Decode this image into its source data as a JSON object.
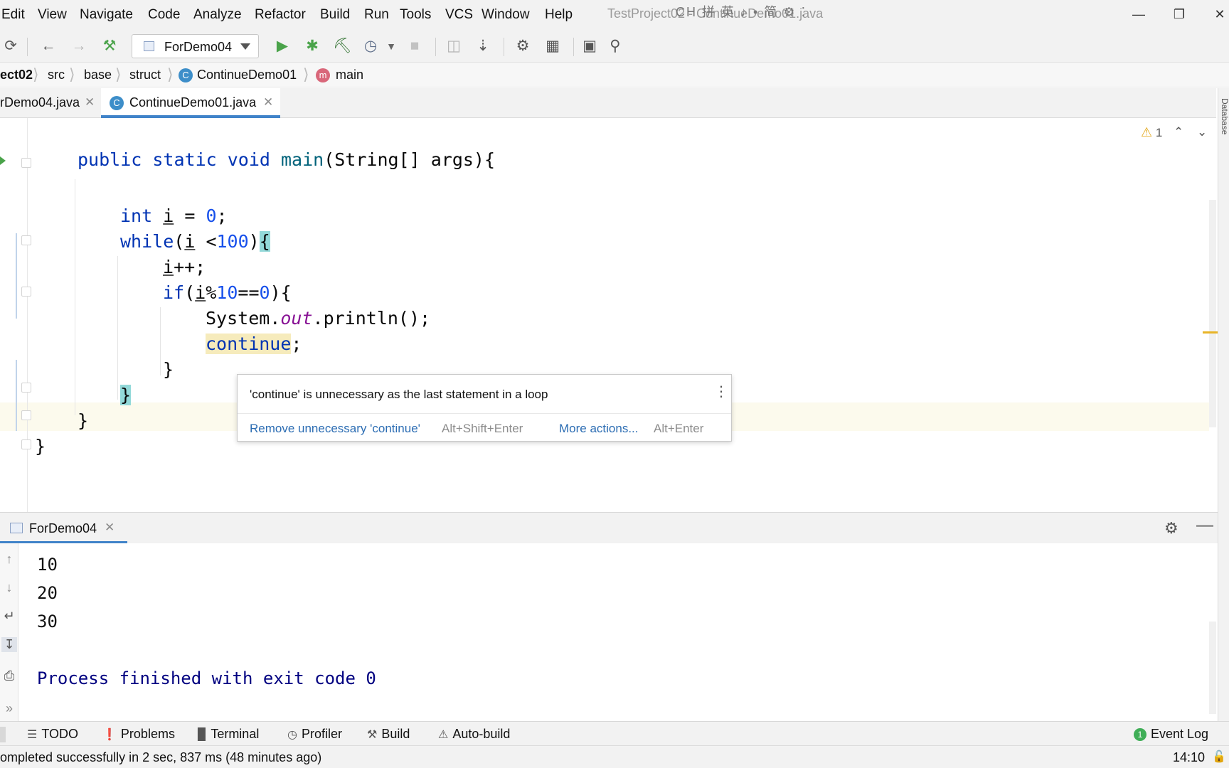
{
  "menu": {
    "items": [
      "Edit",
      "View",
      "Navigate",
      "Code",
      "Analyze",
      "Refactor",
      "Build",
      "Run",
      "Tools",
      "VCS",
      "Window",
      "Help"
    ]
  },
  "window": {
    "title": "TestProject02 - ContinueDemo01.java",
    "ime_icons": "CH 拼 英 ♪ • 简 ⚙ ⁚"
  },
  "toolbar": {
    "run_config": "ForDemo04"
  },
  "breadcrumb": {
    "items": [
      "ect02",
      "src",
      "base",
      "struct",
      "ContinueDemo01",
      "main"
    ],
    "class_badge": "C",
    "method_badge": "m"
  },
  "tabs": [
    {
      "label": "rDemo04.java"
    },
    {
      "label": "ContinueDemo01.java",
      "badge": "C"
    }
  ],
  "side_panel": {
    "label": "Database"
  },
  "editor": {
    "warning_count": "1",
    "popup": {
      "message": "'continue' is unnecessary as the last statement in a loop",
      "action_primary": "Remove unnecessary 'continue'",
      "shortcut_primary": "Alt+Shift+Enter",
      "action_secondary": "More actions...",
      "shortcut_secondary": "Alt+Enter"
    }
  },
  "run_panel": {
    "tab_label": "ForDemo04",
    "output": [
      "10",
      "20",
      "30"
    ],
    "finish": "Process finished with exit code 0"
  },
  "tool_windows": [
    {
      "label": "TODO",
      "icon": "list-icon"
    },
    {
      "label": "Problems",
      "icon": "info-icon"
    },
    {
      "label": "Terminal",
      "icon": "terminal-icon"
    },
    {
      "label": "Profiler",
      "icon": "profiler-icon"
    },
    {
      "label": "Build",
      "icon": "hammer-icon"
    },
    {
      "label": "Auto-build",
      "icon": "warning-icon"
    }
  ],
  "event_log": {
    "label": "Event Log",
    "count": "1"
  },
  "status": {
    "message": "ompleted successfully in 2 sec, 837 ms (48 minutes ago)",
    "position": "14:10",
    "accent_color": "#4083c9",
    "warning_color": "#e3a81b"
  }
}
